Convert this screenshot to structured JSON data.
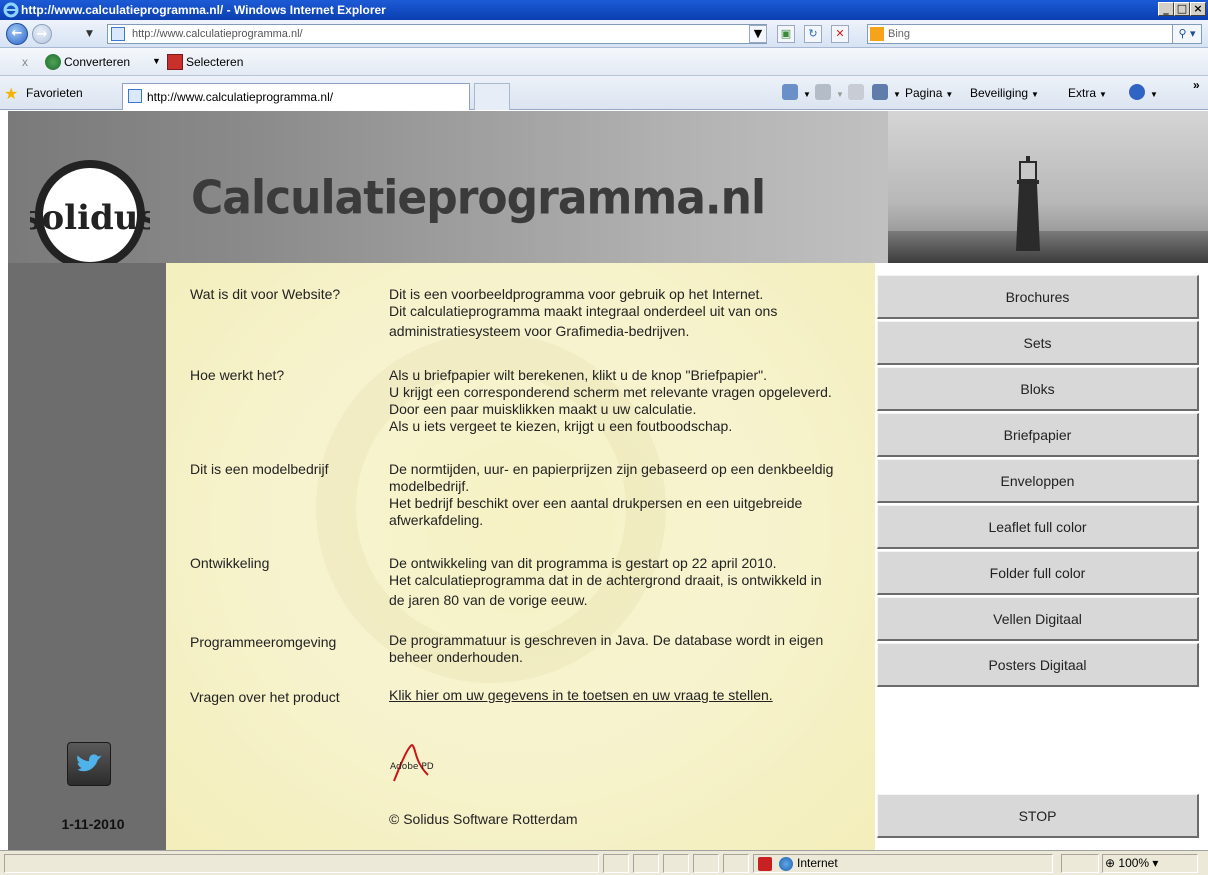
{
  "browser": {
    "window_title": "http://www.calculatieprogramma.nl/ - Windows Internet Explorer",
    "url": "http://www.calculatieprogramma.nl/",
    "search_placeholder": "Bing",
    "cmd_convert": "Converteren",
    "cmd_select": "Selecteren",
    "favorites_label": "Favorieten",
    "tab_title": "http://www.calculatieprogramma.nl/",
    "tool_page": "Pagina",
    "tool_security": "Beveiliging",
    "tool_extra": "Extra",
    "status_zone": "Internet",
    "zoom": "100%",
    "minimize_glyph": "_",
    "maximize_glyph": "□",
    "close_glyph": "×",
    "more_glyph": "»"
  },
  "site": {
    "title": "Calculatieprogramma.nl",
    "logo_text": "solidus",
    "adobe_text": "Adobe PDF",
    "date": "1-11-2010",
    "copyright": "© Solidus Software Rotterdam"
  },
  "qa": [
    {
      "label": "Wat is dit voor Website?",
      "lines": [
        "Dit is een voorbeeldprogramma voor gebruik op het Internet.",
        "Dit calculatieprogramma maakt integraal onderdeel uit van ons",
        "administratiesysteem voor Grafimedia-bedrijven."
      ]
    },
    {
      "label": "Hoe werkt het?",
      "lines": [
        "Als u briefpapier wilt berekenen, klikt u de knop \"Briefpapier\".",
        "U krijgt een corresponderend scherm met relevante vragen opgeleverd.",
        "Door een paar muisklikken maakt u uw calculatie.",
        "Als u iets vergeet te kiezen, krijgt u een foutboodschap."
      ]
    },
    {
      "label": "Dit is een modelbedrijf",
      "lines": [
        "De normtijden, uur- en papierprijzen zijn gebaseerd op een denkbeeldig",
        "modelbedrijf.",
        "Het bedrijf beschikt over een aantal drukpersen en een uitgebreide",
        "afwerkafdeling."
      ]
    },
    {
      "label": "Ontwikkeling",
      "lines": [
        "De ontwikkeling van dit programma is gestart op 22 april 2010.",
        "Het calculatieprogramma dat in de achtergrond draait, is ontwikkeld in",
        "de jaren 80 van de vorige eeuw."
      ]
    },
    {
      "label": "Programmeeromgeving",
      "lines": [
        "De programmatuur is geschreven in Java. De database wordt in eigen",
        "beheer onderhouden."
      ]
    },
    {
      "label": "Vragen over het product",
      "link": "Klik hier om uw gegevens in te toetsen en uw vraag te stellen."
    }
  ],
  "menu": [
    "Brochures",
    "Sets",
    "Bloks",
    "Briefpapier",
    "Enveloppen",
    "Leaflet full color",
    "Folder full color",
    "Vellen Digitaal",
    "Posters Digitaal"
  ],
  "stop_label": "STOP",
  "colors": {
    "content_bg": "#f6f2c4",
    "sidebar_bg": "#6d6d6d",
    "button_bg": "#d8d8d8",
    "titlebar": "#0a3fb0"
  }
}
